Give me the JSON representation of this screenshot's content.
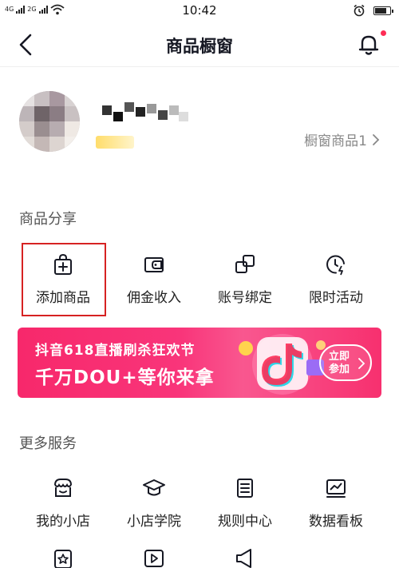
{
  "status_bar": {
    "network_1": "4G",
    "network_2": "2G",
    "time": "10:42",
    "battery_level": 0.85
  },
  "nav": {
    "title": "商品橱窗",
    "back_icon": "back-arrow-icon",
    "bell_icon": "bell-icon",
    "accent_color": "#fe2c55"
  },
  "profile": {
    "window_goods_label": "橱窗商品1"
  },
  "sections": {
    "share_title": "商品分享",
    "more_title": "更多服务"
  },
  "share_items": [
    {
      "label": "添加商品",
      "icon": "shopping-bag-plus-icon"
    },
    {
      "label": "佣金收入",
      "icon": "wallet-icon"
    },
    {
      "label": "账号绑定",
      "icon": "link-icon"
    },
    {
      "label": "限时活动",
      "icon": "clock-lightning-icon"
    }
  ],
  "banner": {
    "line1": "抖音618直播刷杀狂欢节",
    "line2": "千万DOU+等你来拿",
    "button": "立即参加",
    "color": "#f7286b"
  },
  "more_items": [
    {
      "label": "我的小店",
      "icon": "store-icon"
    },
    {
      "label": "小店学院",
      "icon": "graduation-cap-icon"
    },
    {
      "label": "规则中心",
      "icon": "document-icon"
    },
    {
      "label": "数据看板",
      "icon": "chart-icon"
    }
  ],
  "extra_icons": [
    "star-box-icon",
    "video-icon",
    "megaphone-icon"
  ]
}
